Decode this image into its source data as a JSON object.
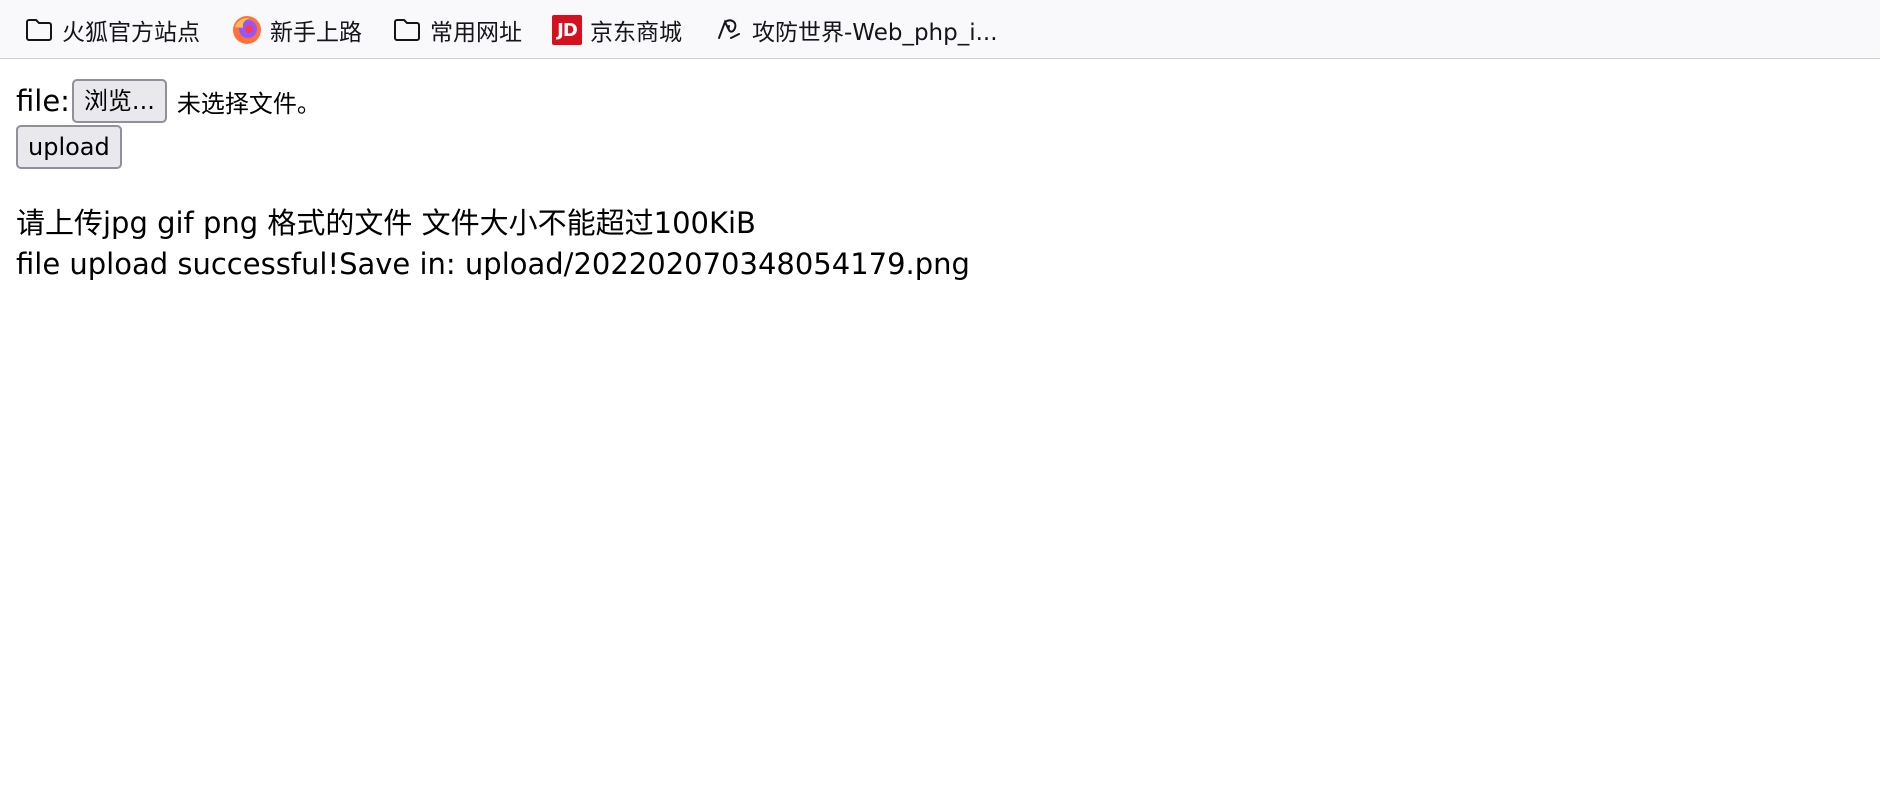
{
  "bookmarks": [
    {
      "label": "火狐官方站点",
      "icon": "folder-icon"
    },
    {
      "label": "新手上路",
      "icon": "firefox-icon"
    },
    {
      "label": "常用网址",
      "icon": "folder-icon"
    },
    {
      "label": "京东商城",
      "icon": "jd-icon",
      "badge": "JD"
    },
    {
      "label": "攻防世界-Web_php_i...",
      "icon": "adworld-icon"
    }
  ],
  "form": {
    "file_label": "file:",
    "browse_button": "浏览...",
    "file_status": "未选择文件。",
    "upload_button": "upload"
  },
  "messages": {
    "requirement": "请上传jpg gif png 格式的文件 文件大小不能超过100KiB",
    "result": "file upload successful!Save in: upload/20220207034805 4179.png"
  },
  "colors": {
    "toolbar_bg": "#f9f9fb",
    "button_bg": "#e9e9ed",
    "button_border": "#8f8f9d",
    "jd_red": "#d7101e"
  }
}
